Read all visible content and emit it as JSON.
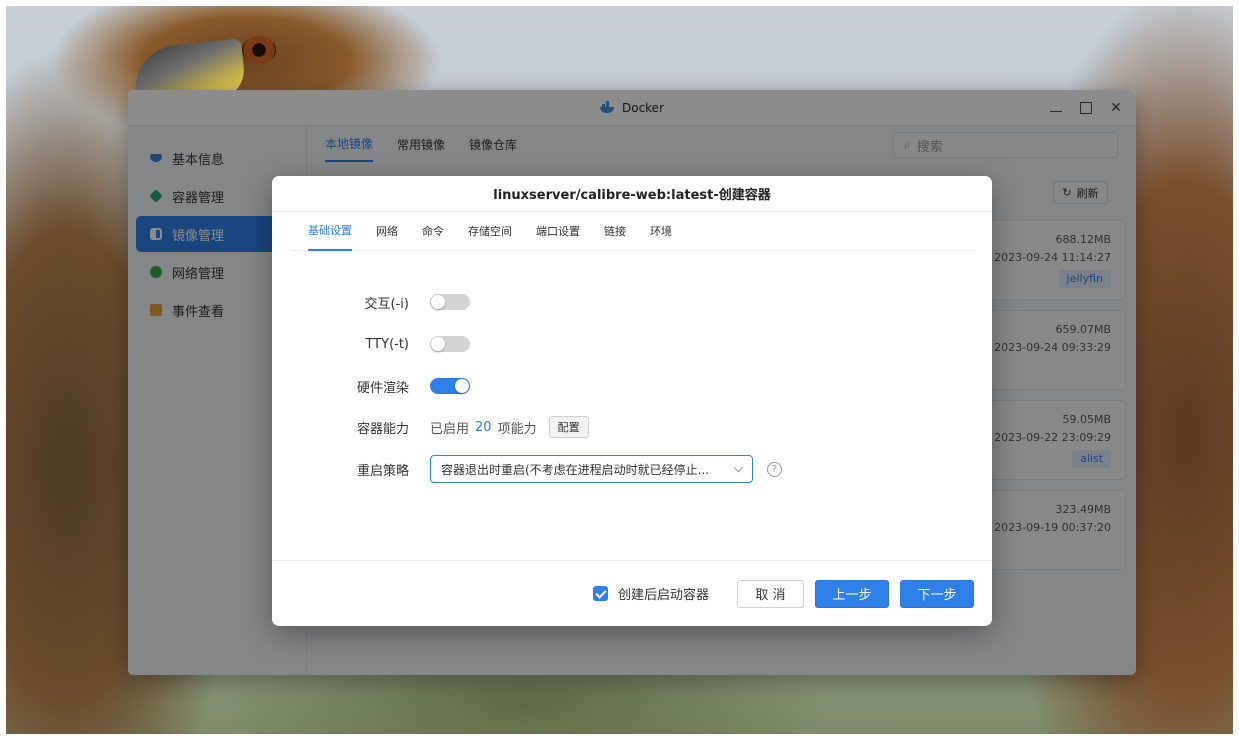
{
  "window": {
    "title": "Docker"
  },
  "sidebar": {
    "items": [
      {
        "label": "基本信息",
        "icon": "docker-small-icon",
        "color": "#3c7fd6"
      },
      {
        "label": "容器管理",
        "icon": "cube-icon",
        "color": "#2ba37a"
      },
      {
        "label": "镜像管理",
        "icon": "image-icon",
        "color": "#ffffff",
        "active": true
      },
      {
        "label": "网络管理",
        "icon": "globe-icon",
        "color": "#36a84a"
      },
      {
        "label": "事件查看",
        "icon": "calendar-icon",
        "color": "#e8a23a"
      }
    ]
  },
  "main": {
    "tabs": [
      {
        "label": "本地镜像",
        "active": true
      },
      {
        "label": "常用镜像"
      },
      {
        "label": "镜像仓库"
      }
    ],
    "search_placeholder": "搜索",
    "refresh_label": "刷新",
    "images": [
      {
        "size": "688.12MB",
        "date": "2023-09-24 11:14:27",
        "tag": "jellyfin"
      },
      {
        "size": "659.07MB",
        "date": "2023-09-24 09:33:29",
        "tag": ""
      },
      {
        "size": "59.05MB",
        "date": "2023-09-22 23:09:29",
        "tag": "alist"
      },
      {
        "size": "323.49MB",
        "date": "2023-09-19 00:37:20",
        "tag": ""
      }
    ]
  },
  "modal": {
    "title": "linuxserver/calibre-web:latest-创建容器",
    "tabs": [
      {
        "label": "基础设置",
        "active": true
      },
      {
        "label": "网络"
      },
      {
        "label": "命令"
      },
      {
        "label": "存储空间"
      },
      {
        "label": "端口设置"
      },
      {
        "label": "链接"
      },
      {
        "label": "环境"
      }
    ],
    "fields": {
      "interactive": {
        "label": "交互(-i)",
        "on": false
      },
      "tty": {
        "label": "TTY(-t)",
        "on": false
      },
      "hw_render": {
        "label": "硬件渲染",
        "on": true
      },
      "capabilities": {
        "label": "容器能力",
        "prefix": "已启用",
        "count": "20",
        "suffix": "项能力",
        "button": "配置"
      },
      "restart": {
        "label": "重启策略",
        "value": "容器退出时重启(不考虑在进程启动时就已经停止..."
      }
    },
    "footer": {
      "start_after_create": "创建后启动容器",
      "cancel": "取 消",
      "prev": "上一步",
      "next": "下一步"
    }
  },
  "colors": {
    "accent": "#2f7fe8"
  }
}
